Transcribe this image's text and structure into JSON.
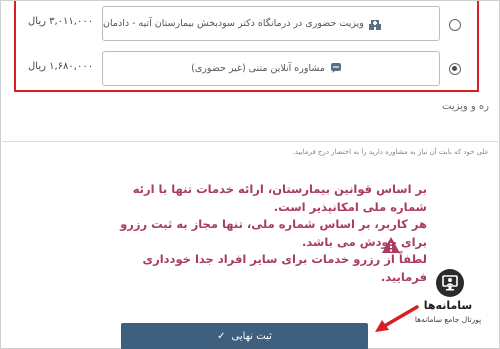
{
  "options": [
    {
      "label": "ویزیت حضوری در درمانگاه دکتر سودبخش بیمارستان آتیه - دادمان",
      "price": "۳,۰۱۱,۰۰۰ ریال",
      "icon": "hospital-icon",
      "selected": false
    },
    {
      "label": "مشاوره آنلاین متنی (غیر حضوری)",
      "price": "۱,۶۸۰,۰۰۰ ریال",
      "icon": "chat-icon",
      "selected": true
    }
  ],
  "section": {
    "title": "ره و ویزیت",
    "hint": "علی خود که بابت آن نیاز به مشاوره دارید را به اختصار درج فرمایید."
  },
  "warning": {
    "icon": "warning-icon",
    "lines": [
      "بر اساس قوانین بیمارستان، ارائه خدمات تنها با ارئه",
      "شماره ملی امکانپذیر است.",
      "هر کاربر، بر اساس شماره ملی، تنها مجاز به ثبت رزرو",
      "برای خودش می باشد.",
      "لطفاً از رزرو خدمات برای سایر افراد جدا خودداری",
      "فرمایید."
    ],
    "color": "#a93c60"
  },
  "submit": {
    "label": "ثبت نهایی",
    "icon": "check-icon",
    "color": "#3f5f7f"
  },
  "brand": {
    "name": "سامانه‌ها",
    "tagline": "پورتال جامع سامانه‌ها",
    "icon": "monitor-person-icon"
  },
  "accent": {
    "highlight_border": "#d81f26",
    "arrow": "#d81f26"
  }
}
